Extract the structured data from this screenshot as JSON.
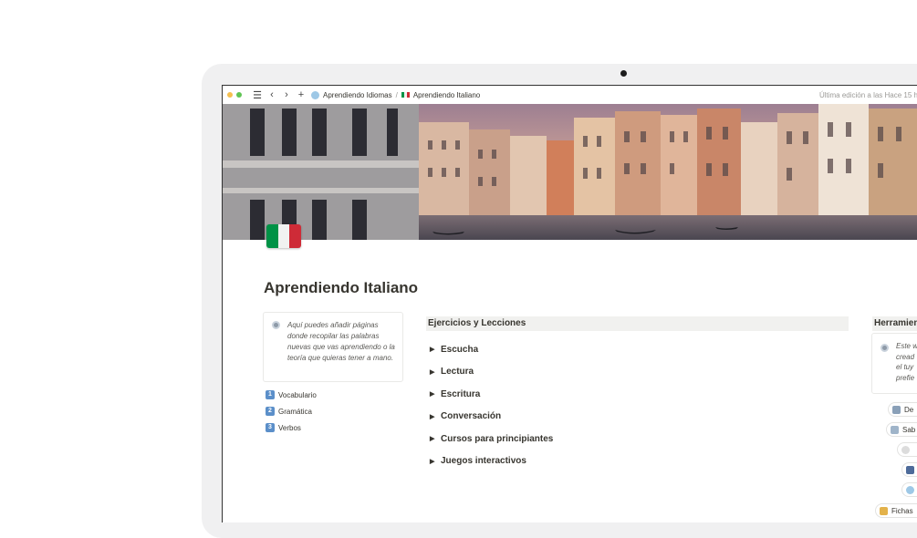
{
  "window": {
    "breadcrumb_parent": "Aprendiendo Idiomas",
    "breadcrumb_sep": "/",
    "breadcrumb_current": "Aprendiendo Italiano",
    "last_edited": "Última edición a las Hace 15 h",
    "nav_icons": [
      "menu-icon",
      "back-icon",
      "forward-icon",
      "add-icon"
    ]
  },
  "colors": {
    "traffic_yellow": "#f5bf4f",
    "traffic_green": "#5fc454",
    "flag_green": "#009246",
    "flag_white": "#f1f2f1",
    "flag_red": "#ce2b37"
  },
  "page": {
    "title": "Aprendiendo Italiano",
    "callout_text": "Aquí puedes añadir páginas donde recopilar las palabras nuevas que vas aprendiendo o la teoría que quieras tener a mano.",
    "nav_items": [
      {
        "num": "1",
        "label": "Vocabulario"
      },
      {
        "num": "2",
        "label": "Gramática"
      },
      {
        "num": "3",
        "label": "Verbos"
      }
    ],
    "section_title": "Ejercicios y Lecciones",
    "toggles": [
      "Escucha",
      "Lectura",
      "Escritura",
      "Conversación",
      "Cursos para principiantes",
      "Juegos interactivos"
    ],
    "right_section_title": "Herramien",
    "right_callout_lines": [
      "Este w",
      "cread",
      "el tuy",
      "prefie"
    ],
    "right_pills": [
      "De",
      "Sab",
      "",
      "",
      "",
      "Fichas"
    ]
  }
}
